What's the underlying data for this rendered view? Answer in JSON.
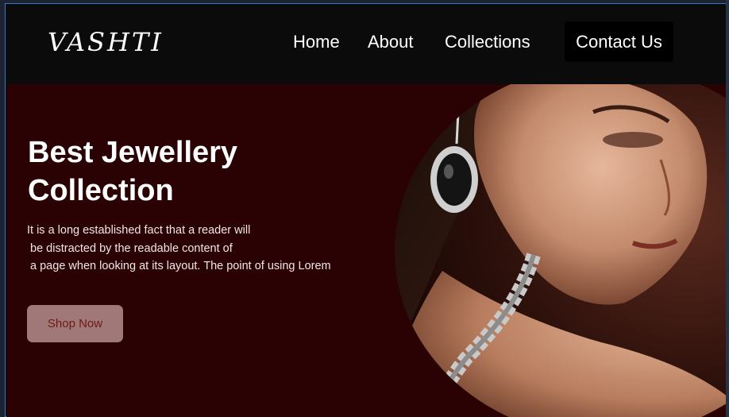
{
  "brand": {
    "logo_text": "VASHTI"
  },
  "nav": {
    "home_label": "Home",
    "about_label": "About",
    "collections_label": "Collections",
    "contact_label": "Contact Us"
  },
  "hero": {
    "title": "Best Jewellery\nCollection",
    "description": "It is a long established fact that a reader will\n be distracted by the readable content of\n a page when looking at its layout. The point of using Lorem",
    "cta_label": "Shop Now"
  },
  "colors": {
    "navbar_bg": "#0b0b0b",
    "hero_bg": "#2a0204",
    "cta_bg": "#a07877",
    "cta_text": "#6e1a14"
  }
}
